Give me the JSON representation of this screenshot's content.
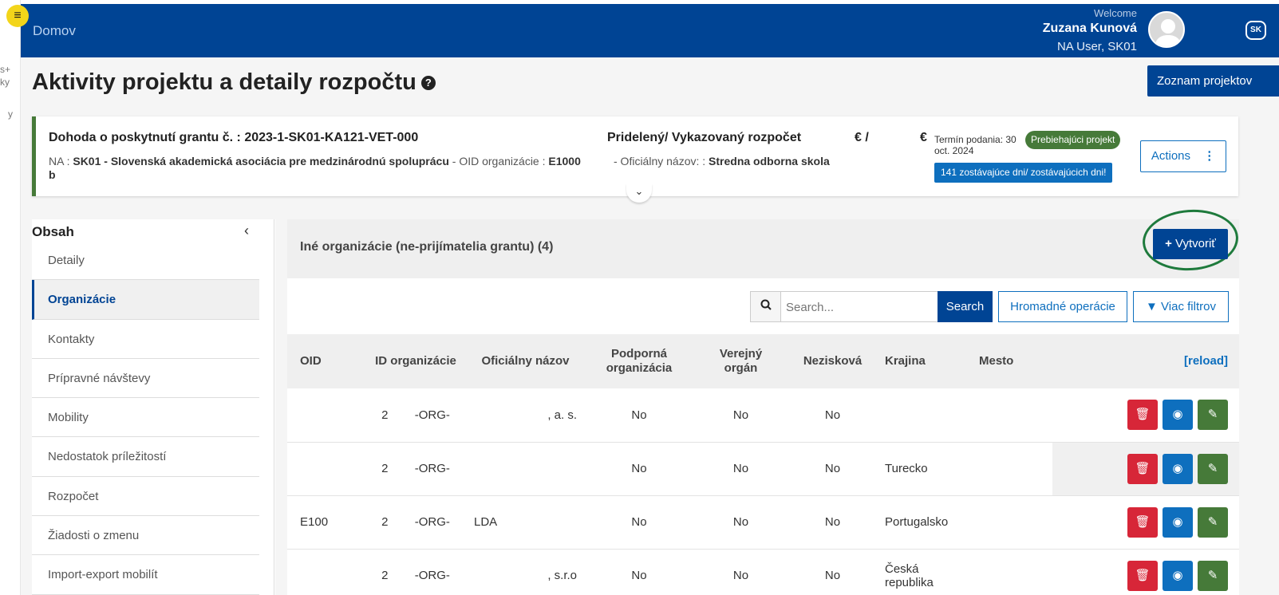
{
  "header": {
    "home": "Domov",
    "welcome": "Welcome",
    "user_name": "Zuzana Kunová",
    "user_role": "NA User, SK01",
    "lang": "SK"
  },
  "left_strip": {
    "fragments": [
      "s+",
      "ky",
      "y"
    ]
  },
  "page": {
    "title": "Aktivity projektu a detaily rozpočtu",
    "projects_button": "Zoznam projektov"
  },
  "grant": {
    "title": "Dohoda o poskytnutí grantu č. : 2023-1-SK01-KA121-VET-000",
    "na_label": "NA : ",
    "na_value": "SK01 - Slovenská akademická asociácia pre medzinárodnú spoluprácu",
    "oid_label": " - OID organizácie : ",
    "oid_value": "E1000",
    "oid_tail": "b",
    "budget_title": "Pridelený/ Vykazovaný rozpočet",
    "budget_eur1": "€ /",
    "budget_eur2": "€",
    "official_label": "- Oficiálny názov: : ",
    "official_value": "Stredna odborna skola",
    "deadline": "Termín podania: 30 oct. 2024",
    "status_badge": "Prebiehajúci projekt",
    "remaining_badge": "141 zostávajúce dni/ zostávajúcich dni!",
    "actions_label": "Actions"
  },
  "sidebar": {
    "title": "Obsah",
    "items": [
      {
        "label": "Detaily"
      },
      {
        "label": "Organizácie"
      },
      {
        "label": "Kontakty"
      },
      {
        "label": "Prípravné návštevy"
      },
      {
        "label": "Mobility"
      },
      {
        "label": "Nedostatok príležitostí"
      },
      {
        "label": "Rozpočet"
      },
      {
        "label": "Žiadosti o zmenu"
      },
      {
        "label": "Import-export mobilít"
      }
    ],
    "active_index": 1
  },
  "panel": {
    "title": "Iné organizácie (ne-prijímatelia grantu) (4)",
    "create_label": "Vytvoriť",
    "search_placeholder": "Search...",
    "search_button": "Search",
    "bulk_button": "Hromadné operácie",
    "filter_button": "Viac filtrov"
  },
  "table": {
    "headers": {
      "oid": "OID",
      "org_id": "ID organizácie",
      "name": "Oficiálny názov",
      "support": "Podporná organizácia",
      "public": "Verejný orgán",
      "nonprofit": "Nezisková",
      "country": "Krajina",
      "city": "Mesto",
      "reload": "[reload]"
    },
    "rows": [
      {
        "oid": "",
        "org_id": "2        -ORG-",
        "name": ", a. s.",
        "support": "No",
        "public": "No",
        "nonprofit": "No",
        "country": "",
        "city": ""
      },
      {
        "oid": "",
        "org_id": "2        -ORG-",
        "name": "",
        "support": "No",
        "public": "No",
        "nonprofit": "No",
        "country": "Turecko",
        "city": ""
      },
      {
        "oid": "E100",
        "org_id": "2        -ORG-",
        "name": "LDA",
        "support": "No",
        "public": "No",
        "nonprofit": "No",
        "country": "Portugalsko",
        "city": ""
      },
      {
        "oid": "",
        "org_id": "2        -ORG-",
        "name": ", s.r.o",
        "support": "No",
        "public": "No",
        "nonprofit": "No",
        "country": "Česká republika",
        "city": ""
      }
    ]
  },
  "colors": {
    "primary": "#004494",
    "accent_blue": "#0e6fbe",
    "success": "#467a39",
    "danger": "#d72638",
    "highlight": "#f3d51a"
  }
}
